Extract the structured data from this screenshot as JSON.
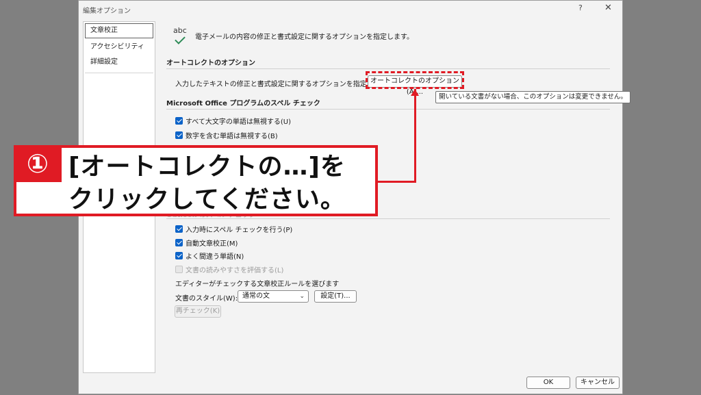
{
  "window": {
    "title": "編集オプション",
    "help": "?",
    "close": "✕"
  },
  "sidebar": {
    "items": [
      {
        "label": "文章校正"
      },
      {
        "label": "アクセシビリティ"
      },
      {
        "label": "詳細設定"
      }
    ]
  },
  "header": {
    "icon_text": "abc",
    "description": "電子メールの内容の修正と書式設定に関するオプションを指定します。"
  },
  "autocorrect": {
    "title": "オートコレクトのオプション",
    "description": "入力したテキストの修正と書式設定に関するオプションを指定します。",
    "button": "オートコレクトのオプション(A)..."
  },
  "tooltip": "開いている文書がない場合、このオプションは変更できません。",
  "spelling": {
    "title": "Microsoft Office プログラムのスペル チェック",
    "items": [
      {
        "label": "すべて大文字の単語は無視する(U)"
      },
      {
        "label": "数字を含む単語は無視する(B)"
      }
    ]
  },
  "outlook": {
    "title": "Outlook のスペル チェック",
    "items": [
      {
        "label": "入力時にスペル チェックを行う(P)"
      },
      {
        "label": "自動文章校正(M)"
      },
      {
        "label": "よく間違う単語(N)"
      },
      {
        "label": "文書の読みやすさを評価する(L)"
      }
    ],
    "rules_label": "エディターがチェックする文章校正ルールを選びます",
    "style_label": "文書のスタイル(W):",
    "style_value": "通常の文",
    "settings_button": "設定(T)...",
    "recheck_button": "再チェック(K)"
  },
  "footer": {
    "ok": "OK",
    "cancel": "キャンセル"
  },
  "callout": {
    "step": "①",
    "line1": "[オートコレクトの…]を",
    "line2": "クリックしてください。"
  },
  "colors": {
    "accent": "#e01b24",
    "checkbox": "#0c63c8"
  }
}
